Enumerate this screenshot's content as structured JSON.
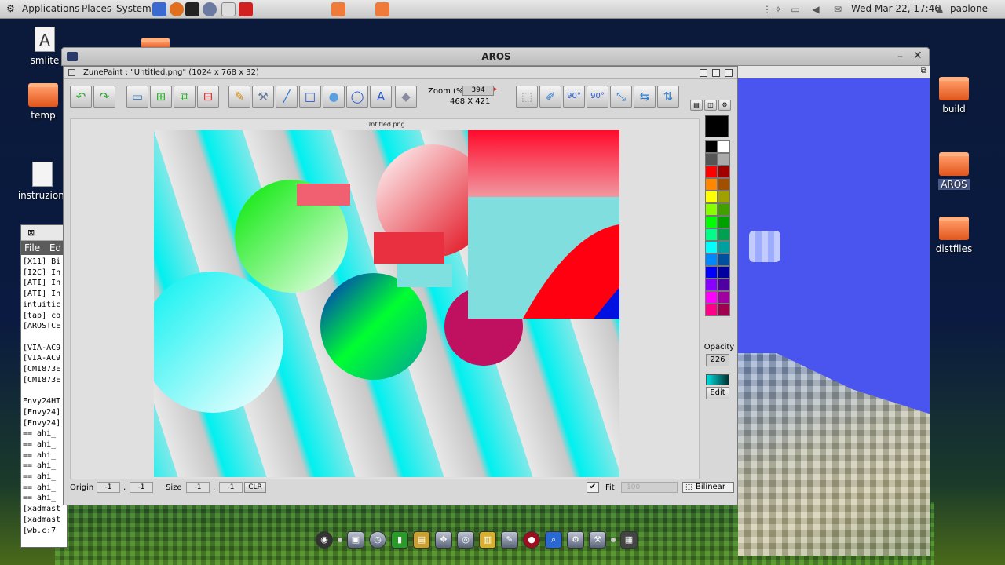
{
  "top_panel": {
    "menus": [
      "Applications",
      "Places",
      "System"
    ],
    "clock": "Wed Mar 22, 17:46",
    "user": "paolone"
  },
  "desktop_icons_left": [
    {
      "label": "smlite",
      "type": "doc"
    },
    {
      "label": "temp",
      "type": "folder"
    },
    {
      "label": "instruzioni",
      "type": "doc"
    }
  ],
  "desktop_icons_right": [
    {
      "label": "build",
      "type": "folder"
    },
    {
      "label": "AROS",
      "type": "folder"
    },
    {
      "label": "distfiles",
      "type": "folder"
    }
  ],
  "terminal": {
    "menu": [
      "File",
      "Ed"
    ],
    "lines": [
      "[X11] Bi",
      "[I2C] In",
      "[ATI] In",
      "[ATI] In",
      "intuitic",
      "[tap] co",
      "[AROSTCE",
      "",
      "[VIA-AC9",
      "[VIA-AC9",
      "[CMI873E",
      "[CMI873E",
      "",
      "Envy24HT",
      "[Envy24]",
      "[Envy24]",
      "== ahi_",
      "== ahi_",
      "== ahi_",
      "== ahi_",
      "== ahi_",
      "== ahi_",
      "== ahi_",
      "[xadmast",
      "[xadmast",
      "[wb.c:7"
    ]
  },
  "aros_window": {
    "title": "AROS"
  },
  "zunepaint": {
    "title": "ZunePaint : \"Untitled.png\" (1024 x 768 x 32)",
    "zoom_label": "Zoom (%)",
    "zoom_value": "394",
    "zoom_dims": "468 X 421",
    "filename": "Untitled.png",
    "opacity_label": "Opacity",
    "opacity_value": "226",
    "edit_label": "Edit",
    "status": {
      "origin_label": "Origin",
      "origin_x": "-1",
      "origin_y": "-1",
      "size_label": "Size",
      "size_x": "-1",
      "size_y": "-1",
      "clr_label": "CLR",
      "fit_label": "Fit",
      "fit_value": "100",
      "bilinear_label": "Bilinear"
    },
    "palette_current": "#000000",
    "palette_swatches": [
      "#000000",
      "#ffffff",
      "#555555",
      "#aaaaaa",
      "#ff0000",
      "#a00000",
      "#ff8800",
      "#a05000",
      "#ffff00",
      "#a0a000",
      "#88ff00",
      "#40a000",
      "#00ff00",
      "#00a000",
      "#00ff88",
      "#00a050",
      "#00ffff",
      "#00a0a0",
      "#0088ff",
      "#0050a0",
      "#0000ff",
      "#0000a0",
      "#8800ff",
      "#5000a0",
      "#ff00ff",
      "#a000a0",
      "#ff0088",
      "#a00050"
    ]
  },
  "tools": [
    {
      "name": "undo-icon",
      "glyph": "↶",
      "color": "#2aa52a"
    },
    {
      "name": "redo-icon",
      "glyph": "↷",
      "color": "#2aa52a"
    },
    {
      "name": "new-canvas-icon",
      "glyph": "▭",
      "color": "#2a7ad0"
    },
    {
      "name": "add-layer-icon",
      "glyph": "⊞",
      "color": "#2aa52a"
    },
    {
      "name": "duplicate-layer-icon",
      "glyph": "⧉",
      "color": "#2aa52a"
    },
    {
      "name": "delete-layer-icon",
      "glyph": "⊟",
      "color": "#d02a2a"
    },
    {
      "name": "pencil-icon",
      "glyph": "✎",
      "color": "#d08a00"
    },
    {
      "name": "brush-icon",
      "glyph": "⚒",
      "color": "#6a7a9a"
    },
    {
      "name": "line-icon",
      "glyph": "╱",
      "color": "#2a7ad0"
    },
    {
      "name": "rectangle-icon",
      "glyph": "□",
      "color": "#2a5ad0"
    },
    {
      "name": "filled-circle-icon",
      "glyph": "●",
      "color": "#5aa0e0"
    },
    {
      "name": "ellipse-icon",
      "glyph": "◯",
      "color": "#2a5ad0"
    },
    {
      "name": "text-icon",
      "glyph": "A",
      "color": "#2a5ad0"
    },
    {
      "name": "eraser-icon",
      "glyph": "◆",
      "color": "#8a8aa0"
    }
  ],
  "tools_right": [
    {
      "name": "crop-icon",
      "glyph": "⬚",
      "color": "#9aa0b0"
    },
    {
      "name": "picker-icon",
      "glyph": "✐",
      "color": "#2a7ad0"
    },
    {
      "name": "rotate-left-icon",
      "glyph": "90°",
      "color": "#2a5ad0"
    },
    {
      "name": "rotate-right-icon",
      "glyph": "90°",
      "color": "#2a5ad0"
    },
    {
      "name": "flip-diagonal-icon",
      "glyph": "⤡",
      "color": "#2a7ad0"
    },
    {
      "name": "flip-horizontal-icon",
      "glyph": "⇆",
      "color": "#2a7ad0"
    },
    {
      "name": "flip-vertical-icon",
      "glyph": "⇅",
      "color": "#2a7ad0"
    }
  ]
}
